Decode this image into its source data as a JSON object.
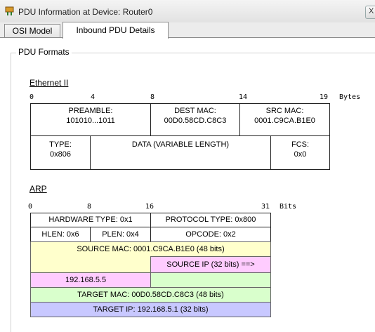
{
  "window": {
    "title": "PDU Information at Device: Router0",
    "close_label": "X"
  },
  "tabs": [
    {
      "label": "OSI Model",
      "active": false
    },
    {
      "label": "Inbound PDU Details",
      "active": true
    }
  ],
  "group_label": "PDU Formats",
  "ethernet": {
    "title": "Ethernet II",
    "scale": {
      "ticks": [
        "0",
        "4",
        "8",
        "14",
        "19"
      ],
      "unit": "Bytes"
    },
    "fields": {
      "preamble": {
        "name": "PREAMBLE:",
        "value": "101010...1011"
      },
      "dest_mac": {
        "name": "DEST MAC:",
        "value": "00D0.58CD.C8C3"
      },
      "src_mac": {
        "name": "SRC MAC:",
        "value": "0001.C9CA.B1E0"
      },
      "type": {
        "name": "TYPE:",
        "value": "0x806"
      },
      "data": {
        "name": "DATA (VARIABLE LENGTH)"
      },
      "fcs": {
        "name": "FCS:",
        "value": "0x0"
      }
    }
  },
  "arp": {
    "title": "ARP",
    "scale": {
      "ticks": [
        "0",
        "8",
        "16",
        "31"
      ],
      "unit": "Bits"
    },
    "fields": {
      "hardware_type": "HARDWARE TYPE: 0x1",
      "protocol_type": "PROTOCOL TYPE: 0x800",
      "hlen": "HLEN: 0x6",
      "plen": "PLEN: 0x4",
      "opcode": "OPCODE: 0x2",
      "source_mac": "SOURCE MAC: 0001.C9CA.B1E0 (48 bits)",
      "source_ip_label": "SOURCE IP (32 bits) ==>",
      "source_ip_value": "192.168.5.5",
      "target_mac": "TARGET MAC: 00D0.58CD.C8C3 (48 bits)",
      "target_ip": "TARGET IP: 192.168.5.1 (32 bits)"
    }
  },
  "colors": {
    "yellow": "#ffffcc",
    "pink": "#ffccff",
    "green": "#d9ffcc",
    "blue": "#c8c8ff"
  }
}
